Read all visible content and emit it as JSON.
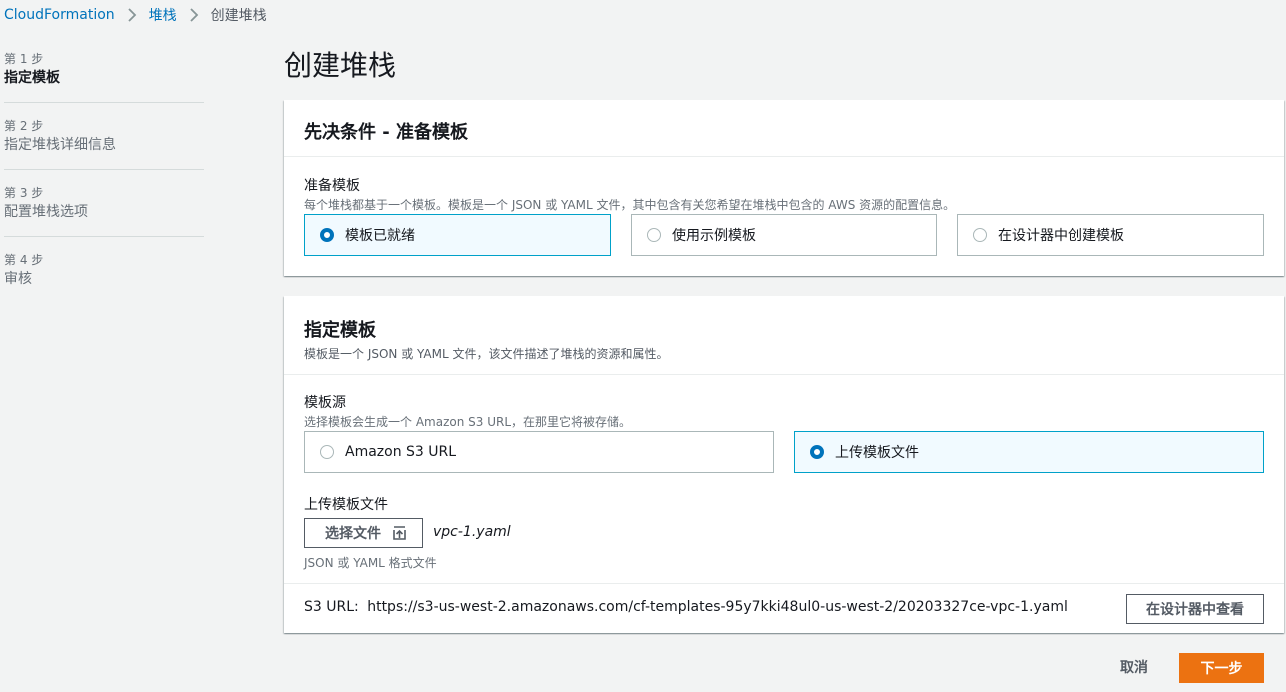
{
  "breadcrumb": {
    "items": [
      "CloudFormation",
      "堆栈",
      "创建堆栈"
    ]
  },
  "steps": [
    {
      "num": "第 1 步",
      "title": "指定模板"
    },
    {
      "num": "第 2 步",
      "title": "指定堆栈详细信息"
    },
    {
      "num": "第 3 步",
      "title": "配置堆栈选项"
    },
    {
      "num": "第 4 步",
      "title": "审核"
    }
  ],
  "page_title": "创建堆栈",
  "prereq_panel": {
    "title": "先决条件 - 准备模板",
    "field_label": "准备模板",
    "field_desc": "每个堆栈都基于一个模板。模板是一个 JSON 或 YAML 文件，其中包含有关您希望在堆栈中包含的 AWS 资源的配置信息。",
    "options": [
      "模板已就绪",
      "使用示例模板",
      "在设计器中创建模板"
    ],
    "selected": "模板已就绪"
  },
  "template_panel": {
    "title": "指定模板",
    "desc": "模板是一个 JSON 或 YAML 文件，该文件描述了堆栈的资源和属性。",
    "source_label": "模板源",
    "source_desc": "选择模板会生成一个 Amazon S3 URL，在那里它将被存储。",
    "source_options": [
      "Amazon S3 URL",
      "上传模板文件"
    ],
    "selected_source": "上传模板文件",
    "upload_label": "上传模板文件",
    "choose_file_label": "选择文件",
    "file_name": "vpc-1.yaml",
    "upload_hint": "JSON 或 YAML 格式文件",
    "s3_url_label": "S3 URL:",
    "s3_url": "https://s3-us-west-2.amazonaws.com/cf-templates-95y7kki48ul0-us-west-2/20203327ce-vpc-1.yaml",
    "view_designer_label": "在设计器中查看"
  },
  "footer": {
    "cancel_label": "取消",
    "next_label": "下一步"
  },
  "colors": {
    "accent": "#0073bb",
    "primary_button": "#ec7211",
    "selected_tile_border": "#00a1c9",
    "selected_tile_bg": "#f1faff"
  },
  "icons": [
    "chevron-right-icon",
    "upload-icon",
    "radio-icon"
  ]
}
